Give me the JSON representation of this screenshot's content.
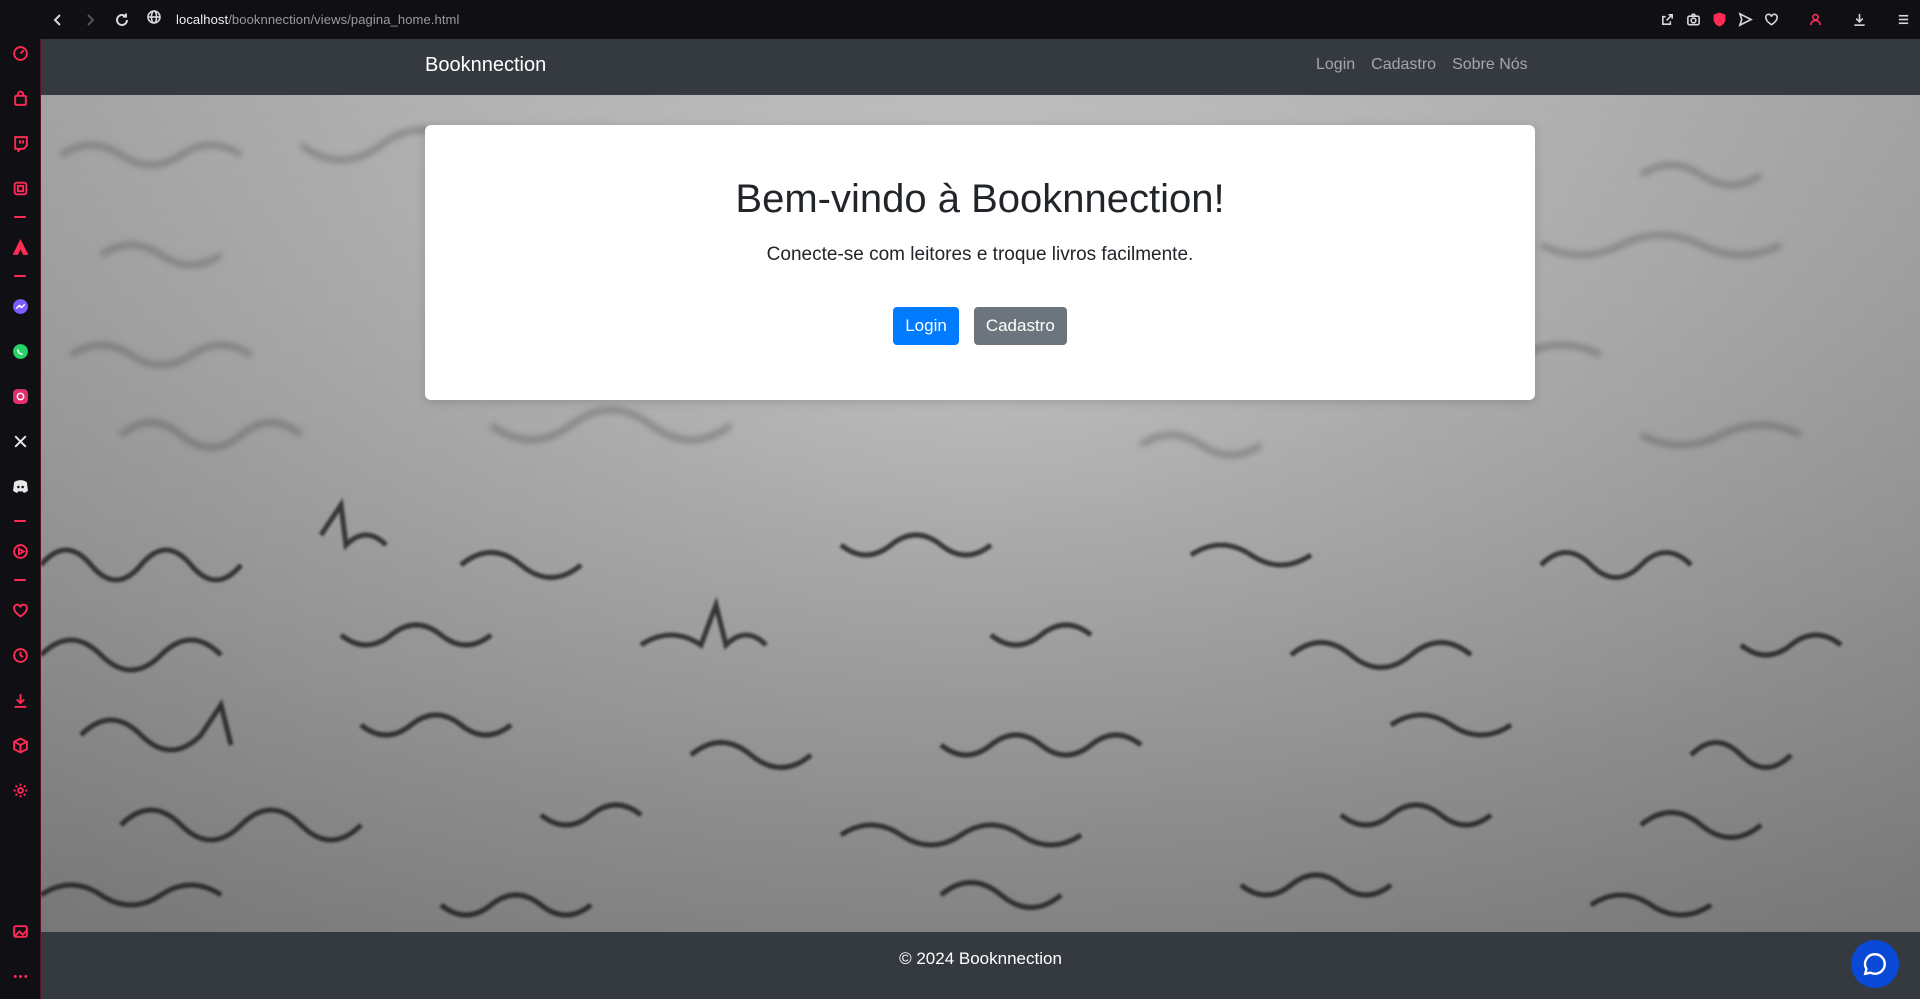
{
  "browser": {
    "url_host": "localhost",
    "url_path": "/booknnection/views/pagina_home.html"
  },
  "sidebar": {
    "items": [
      {
        "icon": "speed-dial-icon"
      },
      {
        "icon": "shopping-bag-icon"
      },
      {
        "icon": "twitch-icon"
      },
      {
        "icon": "player-icon"
      },
      {
        "icon": "aria-icon"
      },
      {
        "icon": "messenger-icon"
      },
      {
        "icon": "whatsapp-icon"
      },
      {
        "icon": "instagram-icon"
      },
      {
        "icon": "x-icon"
      },
      {
        "icon": "discord-icon"
      },
      {
        "icon": "player-icon"
      },
      {
        "icon": "heart-icon"
      },
      {
        "icon": "history-icon"
      },
      {
        "icon": "download-icon"
      },
      {
        "icon": "extensions-icon"
      },
      {
        "icon": "settings-icon"
      },
      {
        "icon": "gallery-icon"
      },
      {
        "icon": "more-icon"
      }
    ]
  },
  "site": {
    "brand": "Booknnection",
    "nav": [
      "Login",
      "Cadastro",
      "Sobre Nós"
    ],
    "hero": {
      "title": "Bem-vindo à Booknnection!",
      "subtitle": "Conecte-se com leitores e troque livros facilmente.",
      "login_button": "Login",
      "signup_button": "Cadastro"
    },
    "footer": "© 2024 Booknnection"
  },
  "colors": {
    "navbar": "#343a40",
    "primary": "#007bff",
    "secondary": "#6c757d",
    "accent": "#ff2a55",
    "chat": "#0a49d6"
  }
}
